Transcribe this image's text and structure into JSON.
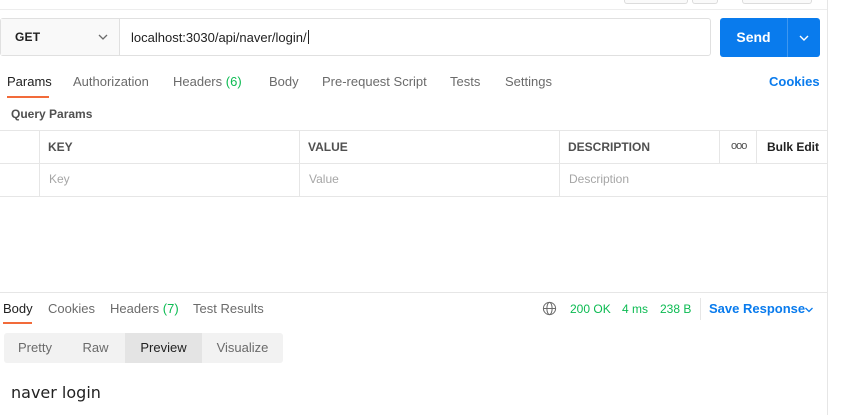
{
  "request": {
    "method": "GET",
    "url": "localhost:3030/api/naver/login/",
    "send_label": "Send"
  },
  "request_tabs": {
    "params": "Params",
    "authorization": "Authorization",
    "headers": "Headers",
    "headers_count": "(6)",
    "body": "Body",
    "pre_request_script": "Pre-request Script",
    "tests": "Tests",
    "settings": "Settings",
    "cookies_link": "Cookies"
  },
  "query_params": {
    "title": "Query Params",
    "columns": {
      "key": "KEY",
      "value": "VALUE",
      "description": "DESCRIPTION"
    },
    "more_label": "ooo",
    "bulk_edit": "Bulk Edit",
    "placeholders": {
      "key": "Key",
      "value": "Value",
      "description": "Description"
    }
  },
  "response": {
    "tabs": {
      "body": "Body",
      "cookies": "Cookies",
      "headers": "Headers",
      "headers_count": "(7)",
      "test_results": "Test Results"
    },
    "status": "200 OK",
    "time": "4 ms",
    "size": "238 B",
    "save_response": "Save Response",
    "view_modes": [
      "Pretty",
      "Raw",
      "Preview",
      "Visualize"
    ],
    "selected_view": "Preview",
    "preview_text": "naver login"
  },
  "colors": {
    "accent_blue": "#097bed",
    "active_tab_orange": "#f26b3a",
    "success_green": "#0cbb52"
  },
  "icons": [
    "chevron-down-icon",
    "globe-icon"
  ]
}
